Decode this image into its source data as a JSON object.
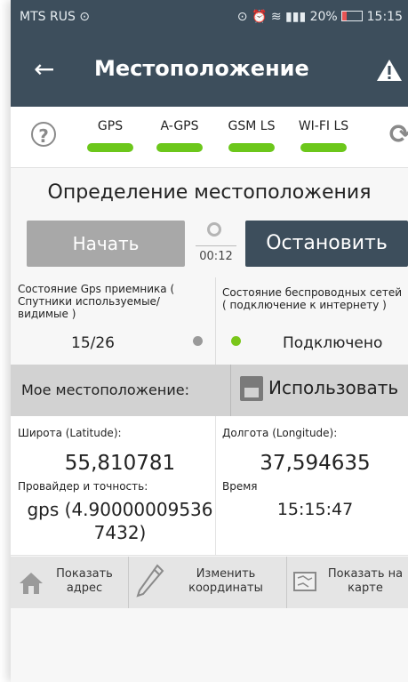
{
  "status_bar": {
    "carrier": "MTS RUS",
    "battery": "20%",
    "time": "15:15"
  },
  "app_bar": {
    "title": "Местоположение"
  },
  "gps_tabs": [
    "GPS",
    "A-GPS",
    "GSM LS",
    "WI-FI LS"
  ],
  "gps_tab_color": "#6cc71b",
  "section_title": "Определение местоположения",
  "buttons": {
    "start": "Начать",
    "stop": "Остановить"
  },
  "timer": "00:12",
  "gps_status": {
    "label": "Состояние Gps приемника ( Спутники используемые/ видимые )",
    "count": "15/26"
  },
  "wireless_status": {
    "label": "Состояние беспроводных сетей ( подключение к интернету )",
    "value": "Подключено"
  },
  "my_location": {
    "label": "Мое местоположение:",
    "use_button": "Использовать"
  },
  "coordinates": {
    "latitude_label": "Широта (Latitude):",
    "latitude": "55,810781",
    "longitude_label": "Долгота (Longitude):",
    "longitude": "37,594635",
    "provider_label": "Провайдер и точность:",
    "provider_value": "gps (4.90000009536 7432)",
    "time_label": "Время",
    "time_value": "15:15:47"
  },
  "bottom_actions": {
    "show_address": "Показать адрес",
    "edit_coords": "Изменить координаты",
    "show_map": "Показать на карте"
  }
}
